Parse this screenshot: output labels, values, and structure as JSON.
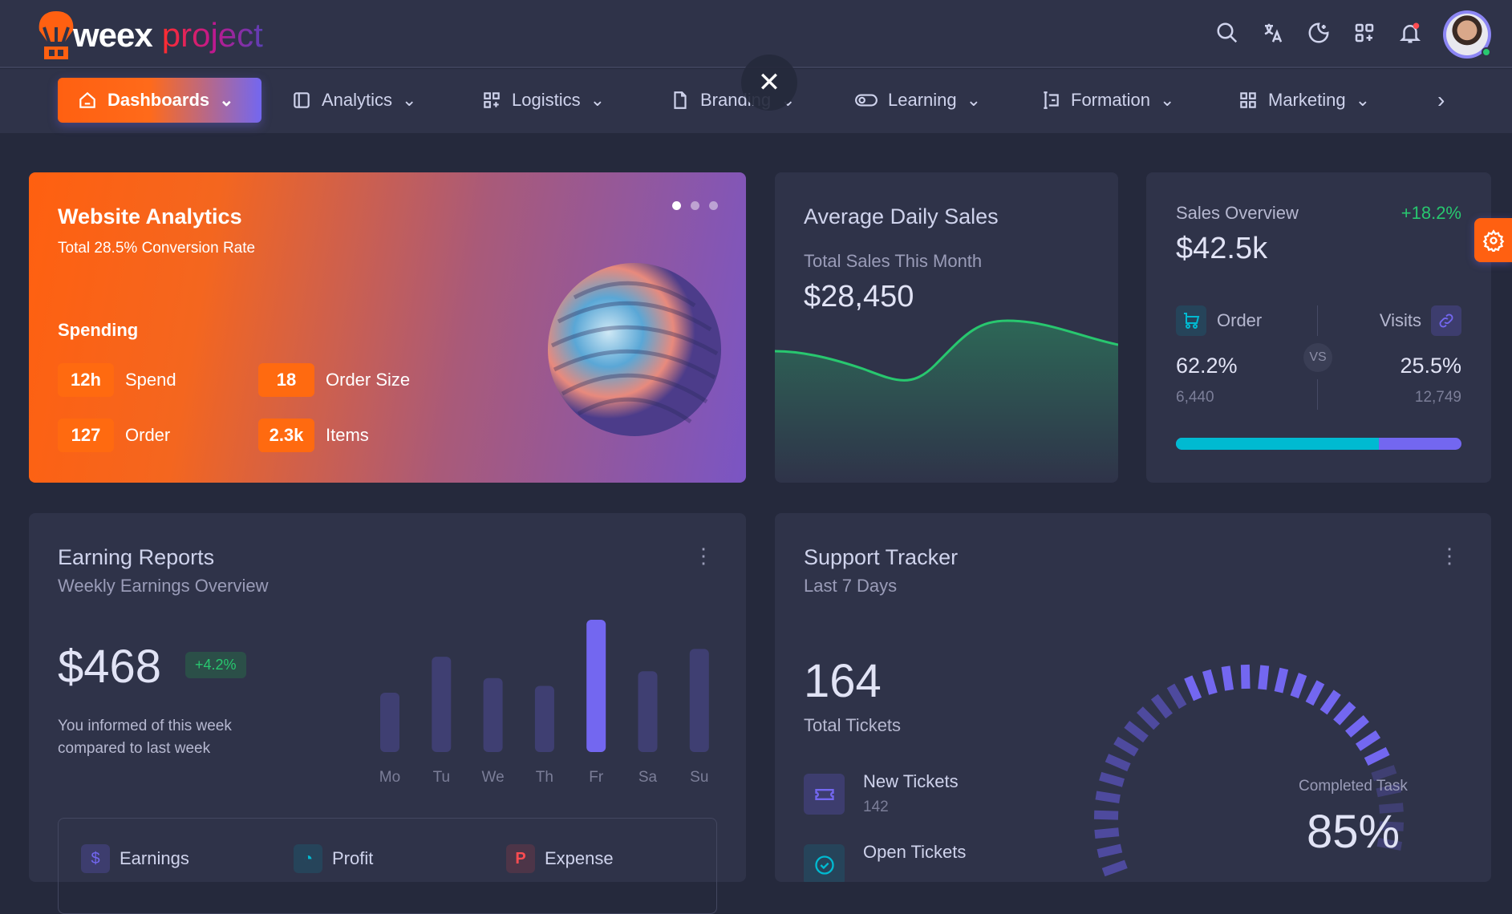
{
  "brand": {
    "name_part1": "weex",
    "name_part2": "project"
  },
  "header_icons": [
    "search-icon",
    "translate-icon",
    "moon-icon",
    "apps-icon",
    "bell-icon"
  ],
  "nav": {
    "items": [
      {
        "label": "Dashboards",
        "icon": "home-icon",
        "active": true
      },
      {
        "label": "Analytics",
        "icon": "layout-icon"
      },
      {
        "label": "Logistics",
        "icon": "grid-plus-icon"
      },
      {
        "label": "Branding",
        "icon": "file-icon"
      },
      {
        "label": "Learning",
        "icon": "toggle-icon"
      },
      {
        "label": "Formation",
        "icon": "form-icon"
      },
      {
        "label": "Marketing",
        "icon": "grid-icon"
      }
    ]
  },
  "website_analytics": {
    "title": "Website Analytics",
    "subtitle": "Total 28.5% Conversion Rate",
    "section": "Spending",
    "stats": [
      {
        "value": "12h",
        "label": "Spend"
      },
      {
        "value": "18",
        "label": "Order Size"
      },
      {
        "value": "127",
        "label": "Order"
      },
      {
        "value": "2.3k",
        "label": "Items"
      }
    ],
    "carousel_active": 1,
    "carousel_count": 3
  },
  "avg_daily_sales": {
    "title": "Average Daily Sales",
    "subtitle": "Total Sales This Month",
    "value": "$28,450"
  },
  "sales_overview": {
    "title": "Sales Overview",
    "change": "+18.2%",
    "value": "$42.5k",
    "order": {
      "label": "Order",
      "percent": "62.2%",
      "count": "6,440"
    },
    "visits": {
      "label": "Visits",
      "percent": "25.5%",
      "count": "12,749"
    },
    "vs": "VS",
    "order_share": 0.71,
    "colors": {
      "order": "#00bad1",
      "visits": "#7367f0"
    }
  },
  "earning_reports": {
    "title": "Earning Reports",
    "subtitle": "Weekly Earnings Overview",
    "value": "$468",
    "change": "+4.2%",
    "note": "You informed of this week compared to last week",
    "chart_data": {
      "type": "bar",
      "categories": [
        "Mo",
        "Tu",
        "We",
        "Th",
        "Fr",
        "Sa",
        "Su"
      ],
      "values": [
        61,
        98,
        76,
        68,
        136,
        83,
        106
      ],
      "highlight": "Fr"
    },
    "legend": [
      {
        "label": "Earnings",
        "icon": "dollar-icon",
        "color": "#7367f0"
      },
      {
        "label": "Profit",
        "icon": "chart-pie-icon",
        "color": "#00bad1"
      },
      {
        "label": "Expense",
        "icon": "paypal-icon",
        "color": "#ff4c51"
      }
    ]
  },
  "support_tracker": {
    "title": "Support Tracker",
    "subtitle": "Last 7 Days",
    "total": "164",
    "total_label": "Total Tickets",
    "items": [
      {
        "label": "New Tickets",
        "count": "142",
        "icon": "ticket-icon"
      },
      {
        "label": "Open Tickets",
        "icon": "check-circle-icon"
      }
    ],
    "gauge_label": "Completed Task",
    "gauge_value": "85%",
    "gauge_fraction": 0.85
  },
  "colors": {
    "primary": "#7367f0",
    "accent": "#ff6011",
    "success": "#28c76f",
    "info": "#00bad1"
  }
}
